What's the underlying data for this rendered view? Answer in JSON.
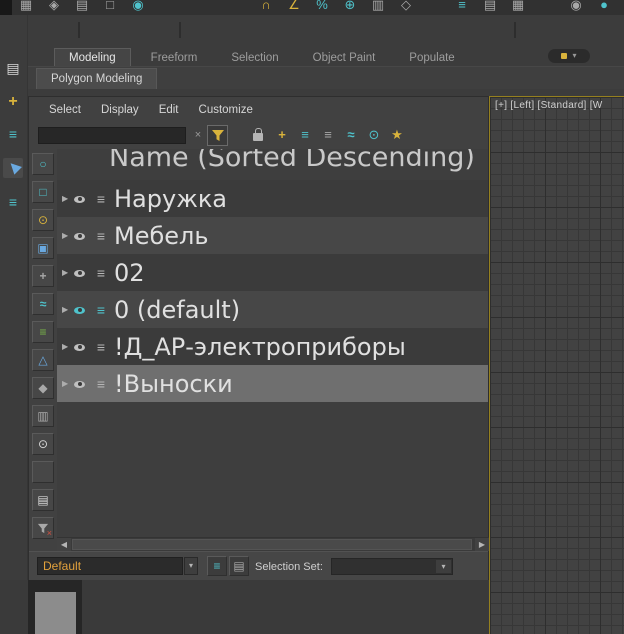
{
  "colors": {
    "accent_yellow": "#d9b33c",
    "accent_teal": "#4fc3cc",
    "accent_blue": "#6aa9e0",
    "selected_row": "#6f6f6f",
    "viewport_border": "#95801f",
    "layer_combo_text": "#e2a13c"
  },
  "topbar": {
    "icons": [
      {
        "name": "selection-filter-icon",
        "glyph": "▦"
      },
      {
        "name": "select-object-icon",
        "glyph": "◈"
      },
      {
        "name": "select-by-name-icon",
        "glyph": "▤"
      },
      {
        "name": "rectangular-selection-icon",
        "glyph": "□"
      },
      {
        "name": "window-crossing-icon",
        "glyph": "◉"
      },
      {
        "name": "snaps-toggle-icon",
        "glyph": "∩"
      },
      {
        "name": "angle-snap-icon",
        "glyph": "∠"
      },
      {
        "name": "percent-snap-icon",
        "glyph": "%"
      },
      {
        "name": "spinner-snap-icon",
        "glyph": "⊕"
      },
      {
        "name": "named-selection-sets-icon",
        "glyph": "▥"
      },
      {
        "name": "mirror-icon",
        "glyph": "◇"
      },
      {
        "name": "align-icon",
        "glyph": "≡"
      },
      {
        "name": "scene-explorer-toggle-icon",
        "glyph": "▤"
      },
      {
        "name": "layer-explorer-toggle-icon",
        "glyph": "▦"
      },
      {
        "name": "curve-editor-icon",
        "glyph": "◉"
      },
      {
        "name": "render-setup-icon",
        "glyph": "●"
      }
    ]
  },
  "leftdock": {
    "icons": [
      {
        "name": "scene-explorer-dock-icon",
        "glyph": "▤"
      },
      {
        "name": "move-gizmo-icon",
        "glyph": "+"
      },
      {
        "name": "layers-dock-icon",
        "glyph": "≡"
      },
      {
        "name": "select-cursor-icon",
        "glyph": "▶"
      },
      {
        "name": "layers-dock-icon-2",
        "glyph": "≡"
      }
    ]
  },
  "ribbon": {
    "tabs": [
      {
        "label": "Modeling",
        "active": true
      },
      {
        "label": "Freeform",
        "active": false
      },
      {
        "label": "Selection",
        "active": false
      },
      {
        "label": "Object Paint",
        "active": false
      },
      {
        "label": "Populate",
        "active": false
      }
    ],
    "overflow_arrow": "▾",
    "subtab": "Polygon Modeling"
  },
  "explorer": {
    "menu": [
      "Select",
      "Display",
      "Edit",
      "Customize"
    ],
    "search": {
      "value": "",
      "clear_glyph": "×"
    },
    "toolbar": {
      "icons": [
        {
          "name": "create-new-layer-icon",
          "glyph": "+"
        },
        {
          "name": "add-to-new-layer-icon",
          "glyph": "≡"
        },
        {
          "name": "make-current-layer-icon",
          "glyph": "≡"
        },
        {
          "name": "select-layer-objects-icon",
          "glyph": "≈"
        },
        {
          "name": "pick-object-layer-icon",
          "glyph": "⊙"
        },
        {
          "name": "layer-properties-icon",
          "glyph": "★"
        }
      ]
    },
    "side_toolbar": {
      "icons": [
        {
          "name": "display-geometry",
          "glyph": "○"
        },
        {
          "name": "display-shapes",
          "glyph": "□"
        },
        {
          "name": "display-lights",
          "glyph": "⊙"
        },
        {
          "name": "display-cameras",
          "glyph": "▣"
        },
        {
          "name": "display-helpers",
          "glyph": "+"
        },
        {
          "name": "display-space-warps",
          "glyph": "≈"
        },
        {
          "name": "display-layers",
          "glyph": "≡"
        },
        {
          "name": "display-bones",
          "glyph": "△"
        },
        {
          "name": "display-materials",
          "glyph": "◆"
        },
        {
          "name": "display-containers",
          "glyph": "▥"
        },
        {
          "name": "display-frozen",
          "glyph": "⊙"
        },
        {
          "name": "blank-toggle",
          "glyph": ""
        },
        {
          "name": "column-chooser",
          "glyph": "▤"
        },
        {
          "name": "clear-filter",
          "glyph": "×"
        }
      ]
    },
    "list": {
      "header": "Name (Sorted Descending)",
      "expand_glyph": "▶",
      "layers_glyph": "≡",
      "rows": [
        {
          "name": "Наружка"
        },
        {
          "name": "Мебель"
        },
        {
          "name": "02"
        },
        {
          "name": "0 (default)"
        },
        {
          "name": "!Д_АР-электроприборы"
        },
        {
          "name": "!Выноски"
        }
      ]
    },
    "scrollbar": {
      "left_glyph": "◀",
      "right_glyph": "▶"
    },
    "bottom": {
      "current_layer": "Default",
      "arrow_glyph": "▾",
      "selection_set_label": "Selection Set:",
      "icons": [
        {
          "name": "open-layer-explorer-icon",
          "glyph": "≡"
        },
        {
          "name": "add-layer-icon",
          "glyph": "▤"
        }
      ]
    }
  },
  "viewport": {
    "label": "[+] [Left] [Standard] [W"
  }
}
